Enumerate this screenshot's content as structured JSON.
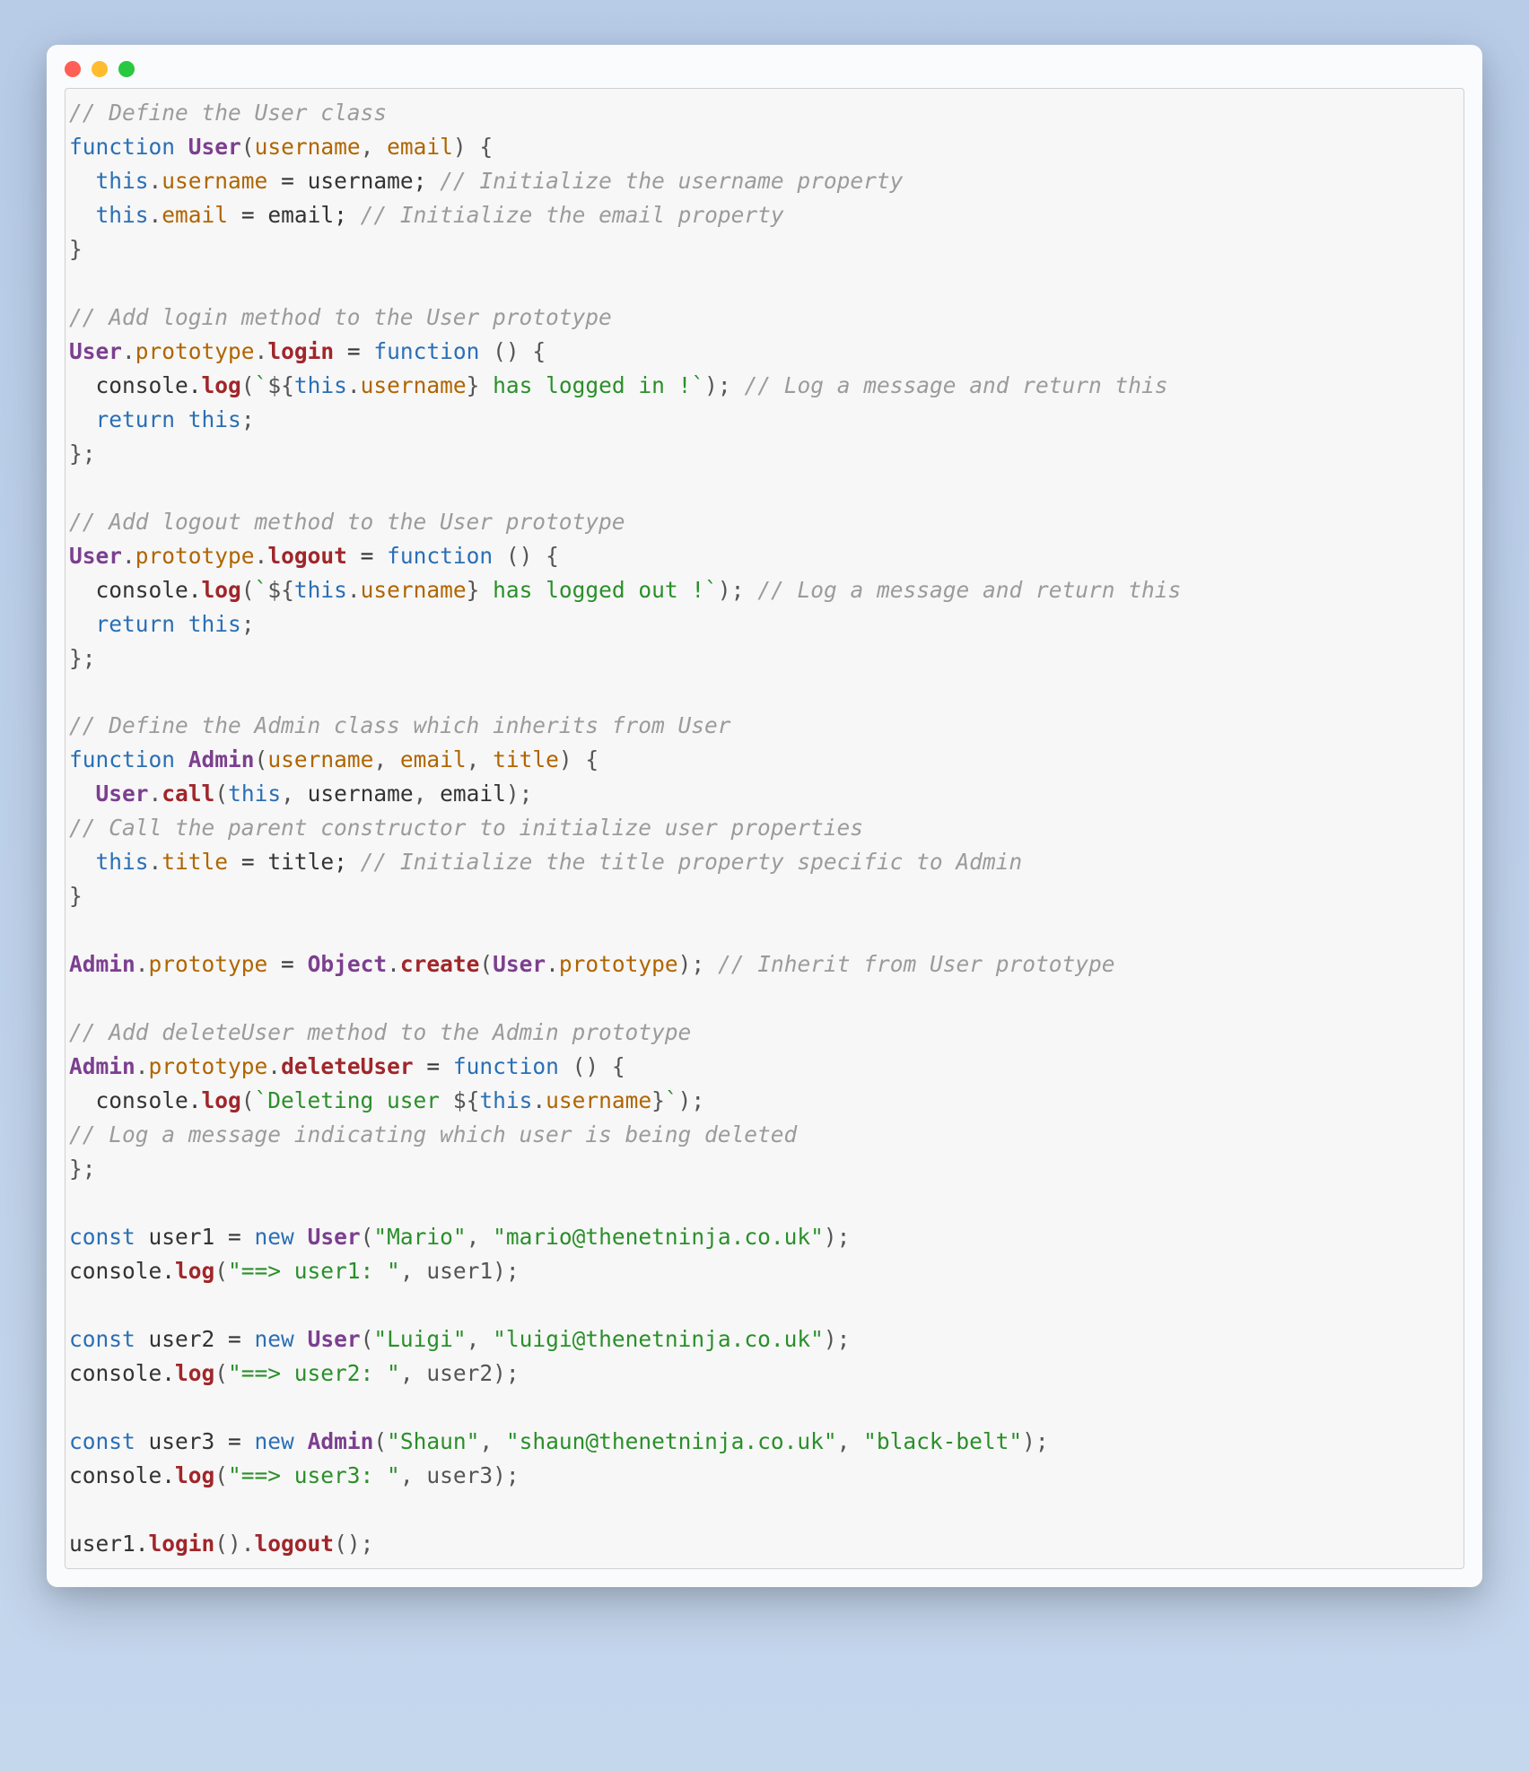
{
  "colors": {
    "traffic_red": "#ff5f57",
    "traffic_yellow": "#febc2e",
    "traffic_green": "#28c840",
    "comment": "#9b9b9b",
    "keyword": "#2a6fb5",
    "identifier": "#7c3f8f",
    "property": "#b06500",
    "method": "#a0262a",
    "string": "#2a8f2a"
  },
  "code": {
    "tokens": [
      [
        [
          "c-comment",
          "// Define the User class"
        ]
      ],
      [
        [
          "c-keyword",
          "function"
        ],
        [
          "c-plain",
          " "
        ],
        [
          "c-fname",
          "User"
        ],
        [
          "c-punct",
          "("
        ],
        [
          "c-param",
          "username"
        ],
        [
          "c-punct",
          ", "
        ],
        [
          "c-param",
          "email"
        ],
        [
          "c-punct",
          ") {"
        ]
      ],
      [
        [
          "c-plain",
          "  "
        ],
        [
          "c-this",
          "this"
        ],
        [
          "c-punct",
          "."
        ],
        [
          "c-prop",
          "username"
        ],
        [
          "c-plain",
          " = username; "
        ],
        [
          "c-comment",
          "// Initialize the username property"
        ]
      ],
      [
        [
          "c-plain",
          "  "
        ],
        [
          "c-this",
          "this"
        ],
        [
          "c-punct",
          "."
        ],
        [
          "c-prop",
          "email"
        ],
        [
          "c-plain",
          " = email; "
        ],
        [
          "c-comment",
          "// Initialize the email property"
        ]
      ],
      [
        [
          "c-punct",
          "}"
        ]
      ],
      [
        [
          "c-plain",
          ""
        ]
      ],
      [
        [
          "c-comment",
          "// Add login method to the User prototype"
        ]
      ],
      [
        [
          "c-class",
          "User"
        ],
        [
          "c-punct",
          "."
        ],
        [
          "c-prop",
          "prototype"
        ],
        [
          "c-punct",
          "."
        ],
        [
          "c-method",
          "login"
        ],
        [
          "c-plain",
          " = "
        ],
        [
          "c-keyword",
          "function"
        ],
        [
          "c-plain",
          " "
        ],
        [
          "c-punct",
          "() {"
        ]
      ],
      [
        [
          "c-plain",
          "  console."
        ],
        [
          "c-method",
          "log"
        ],
        [
          "c-punct",
          "("
        ],
        [
          "c-template",
          "`"
        ],
        [
          "c-punct",
          "${"
        ],
        [
          "c-this",
          "this"
        ],
        [
          "c-punct",
          "."
        ],
        [
          "c-prop",
          "username"
        ],
        [
          "c-punct",
          "}"
        ],
        [
          "c-template",
          " has logged in !`"
        ],
        [
          "c-punct",
          ");"
        ],
        [
          "c-plain",
          " "
        ],
        [
          "c-comment",
          "// Log a message and return this"
        ]
      ],
      [
        [
          "c-plain",
          "  "
        ],
        [
          "c-keyword",
          "return"
        ],
        [
          "c-plain",
          " "
        ],
        [
          "c-this",
          "this"
        ],
        [
          "c-punct",
          ";"
        ]
      ],
      [
        [
          "c-punct",
          "};"
        ]
      ],
      [
        [
          "c-plain",
          ""
        ]
      ],
      [
        [
          "c-comment",
          "// Add logout method to the User prototype"
        ]
      ],
      [
        [
          "c-class",
          "User"
        ],
        [
          "c-punct",
          "."
        ],
        [
          "c-prop",
          "prototype"
        ],
        [
          "c-punct",
          "."
        ],
        [
          "c-method",
          "logout"
        ],
        [
          "c-plain",
          " = "
        ],
        [
          "c-keyword",
          "function"
        ],
        [
          "c-plain",
          " "
        ],
        [
          "c-punct",
          "() {"
        ]
      ],
      [
        [
          "c-plain",
          "  console."
        ],
        [
          "c-method",
          "log"
        ],
        [
          "c-punct",
          "("
        ],
        [
          "c-template",
          "`"
        ],
        [
          "c-punct",
          "${"
        ],
        [
          "c-this",
          "this"
        ],
        [
          "c-punct",
          "."
        ],
        [
          "c-prop",
          "username"
        ],
        [
          "c-punct",
          "}"
        ],
        [
          "c-template",
          " has logged out !`"
        ],
        [
          "c-punct",
          ");"
        ],
        [
          "c-plain",
          " "
        ],
        [
          "c-comment",
          "// Log a message and return this"
        ]
      ],
      [
        [
          "c-plain",
          "  "
        ],
        [
          "c-keyword",
          "return"
        ],
        [
          "c-plain",
          " "
        ],
        [
          "c-this",
          "this"
        ],
        [
          "c-punct",
          ";"
        ]
      ],
      [
        [
          "c-punct",
          "};"
        ]
      ],
      [
        [
          "c-plain",
          ""
        ]
      ],
      [
        [
          "c-comment",
          "// Define the Admin class which inherits from User"
        ]
      ],
      [
        [
          "c-keyword",
          "function"
        ],
        [
          "c-plain",
          " "
        ],
        [
          "c-fname",
          "Admin"
        ],
        [
          "c-punct",
          "("
        ],
        [
          "c-param",
          "username"
        ],
        [
          "c-punct",
          ", "
        ],
        [
          "c-param",
          "email"
        ],
        [
          "c-punct",
          ", "
        ],
        [
          "c-param",
          "title"
        ],
        [
          "c-punct",
          ") {"
        ]
      ],
      [
        [
          "c-plain",
          "  "
        ],
        [
          "c-class",
          "User"
        ],
        [
          "c-punct",
          "."
        ],
        [
          "c-method",
          "call"
        ],
        [
          "c-punct",
          "("
        ],
        [
          "c-this",
          "this"
        ],
        [
          "c-punct",
          ", "
        ],
        [
          "c-plain",
          "username"
        ],
        [
          "c-punct",
          ", "
        ],
        [
          "c-plain",
          "email"
        ],
        [
          "c-punct",
          ");"
        ]
      ],
      [
        [
          "c-comment",
          "// Call the parent constructor to initialize user properties"
        ]
      ],
      [
        [
          "c-plain",
          "  "
        ],
        [
          "c-this",
          "this"
        ],
        [
          "c-punct",
          "."
        ],
        [
          "c-prop",
          "title"
        ],
        [
          "c-plain",
          " = title; "
        ],
        [
          "c-comment",
          "// Initialize the title property specific to Admin"
        ]
      ],
      [
        [
          "c-punct",
          "}"
        ]
      ],
      [
        [
          "c-plain",
          ""
        ]
      ],
      [
        [
          "c-class",
          "Admin"
        ],
        [
          "c-punct",
          "."
        ],
        [
          "c-prop",
          "prototype"
        ],
        [
          "c-plain",
          " = "
        ],
        [
          "c-object",
          "Object"
        ],
        [
          "c-punct",
          "."
        ],
        [
          "c-method",
          "create"
        ],
        [
          "c-punct",
          "("
        ],
        [
          "c-class",
          "User"
        ],
        [
          "c-punct",
          "."
        ],
        [
          "c-prop",
          "prototype"
        ],
        [
          "c-punct",
          "); "
        ],
        [
          "c-comment",
          "// Inherit from User prototype"
        ]
      ],
      [
        [
          "c-plain",
          ""
        ]
      ],
      [
        [
          "c-comment",
          "// Add deleteUser method to the Admin prototype"
        ]
      ],
      [
        [
          "c-class",
          "Admin"
        ],
        [
          "c-punct",
          "."
        ],
        [
          "c-prop",
          "prototype"
        ],
        [
          "c-punct",
          "."
        ],
        [
          "c-method",
          "deleteUser"
        ],
        [
          "c-plain",
          " = "
        ],
        [
          "c-keyword",
          "function"
        ],
        [
          "c-plain",
          " "
        ],
        [
          "c-punct",
          "() {"
        ]
      ],
      [
        [
          "c-plain",
          "  console."
        ],
        [
          "c-method",
          "log"
        ],
        [
          "c-punct",
          "("
        ],
        [
          "c-template",
          "`Deleting user "
        ],
        [
          "c-punct",
          "${"
        ],
        [
          "c-this",
          "this"
        ],
        [
          "c-punct",
          "."
        ],
        [
          "c-prop",
          "username"
        ],
        [
          "c-punct",
          "}"
        ],
        [
          "c-template",
          "`"
        ],
        [
          "c-punct",
          ");"
        ]
      ],
      [
        [
          "c-comment",
          "// Log a message indicating which user is being deleted"
        ]
      ],
      [
        [
          "c-punct",
          "};"
        ]
      ],
      [
        [
          "c-plain",
          ""
        ]
      ],
      [
        [
          "c-keyword",
          "const"
        ],
        [
          "c-plain",
          " user1 = "
        ],
        [
          "c-keyword",
          "new"
        ],
        [
          "c-plain",
          " "
        ],
        [
          "c-class",
          "User"
        ],
        [
          "c-punct",
          "("
        ],
        [
          "c-string",
          "\"Mario\""
        ],
        [
          "c-punct",
          ", "
        ],
        [
          "c-string",
          "\"mario@thenetninja.co.uk\""
        ],
        [
          "c-punct",
          ");"
        ]
      ],
      [
        [
          "c-plain",
          "console."
        ],
        [
          "c-method",
          "log"
        ],
        [
          "c-punct",
          "("
        ],
        [
          "c-string",
          "\"==> user1: \""
        ],
        [
          "c-punct",
          ", user1);"
        ]
      ],
      [
        [
          "c-plain",
          ""
        ]
      ],
      [
        [
          "c-keyword",
          "const"
        ],
        [
          "c-plain",
          " user2 = "
        ],
        [
          "c-keyword",
          "new"
        ],
        [
          "c-plain",
          " "
        ],
        [
          "c-class",
          "User"
        ],
        [
          "c-punct",
          "("
        ],
        [
          "c-string",
          "\"Luigi\""
        ],
        [
          "c-punct",
          ", "
        ],
        [
          "c-string",
          "\"luigi@thenetninja.co.uk\""
        ],
        [
          "c-punct",
          ");"
        ]
      ],
      [
        [
          "c-plain",
          "console."
        ],
        [
          "c-method",
          "log"
        ],
        [
          "c-punct",
          "("
        ],
        [
          "c-string",
          "\"==> user2: \""
        ],
        [
          "c-punct",
          ", user2);"
        ]
      ],
      [
        [
          "c-plain",
          ""
        ]
      ],
      [
        [
          "c-keyword",
          "const"
        ],
        [
          "c-plain",
          " user3 = "
        ],
        [
          "c-keyword",
          "new"
        ],
        [
          "c-plain",
          " "
        ],
        [
          "c-class",
          "Admin"
        ],
        [
          "c-punct",
          "("
        ],
        [
          "c-string",
          "\"Shaun\""
        ],
        [
          "c-punct",
          ", "
        ],
        [
          "c-string",
          "\"shaun@thenetninja.co.uk\""
        ],
        [
          "c-punct",
          ", "
        ],
        [
          "c-string",
          "\"black-belt\""
        ],
        [
          "c-punct",
          ");"
        ]
      ],
      [
        [
          "c-plain",
          "console."
        ],
        [
          "c-method",
          "log"
        ],
        [
          "c-punct",
          "("
        ],
        [
          "c-string",
          "\"==> user3: \""
        ],
        [
          "c-punct",
          ", user3);"
        ]
      ],
      [
        [
          "c-plain",
          ""
        ]
      ],
      [
        [
          "c-plain",
          "user1."
        ],
        [
          "c-method",
          "login"
        ],
        [
          "c-punct",
          "()."
        ],
        [
          "c-method",
          "logout"
        ],
        [
          "c-punct",
          "();"
        ]
      ]
    ]
  }
}
